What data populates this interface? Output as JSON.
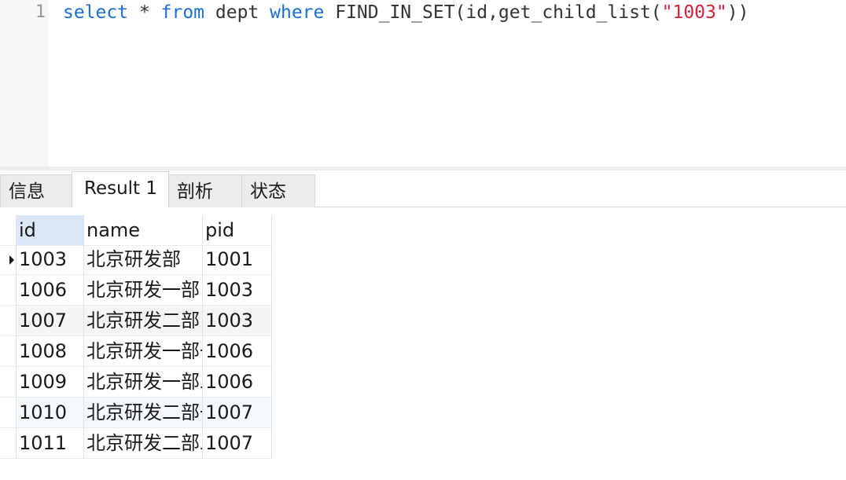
{
  "editor": {
    "line_number": "1",
    "sql": {
      "kw_select": "select",
      "t_star": " * ",
      "kw_from": "from",
      "t_table": " dept ",
      "kw_where": "where",
      "t_func": " FIND_IN_SET(id,get_child_list(",
      "str_arg": "\"1003\"",
      "t_close": "))"
    },
    "colors": {
      "keyword": "#1a6fd6",
      "string": "#d2233c",
      "plain": "#333333"
    }
  },
  "tabs": [
    {
      "label": "信息",
      "active": false
    },
    {
      "label": "Result 1",
      "active": true
    },
    {
      "label": "剖析",
      "active": false
    },
    {
      "label": "状态",
      "active": false
    }
  ],
  "grid": {
    "columns": [
      "id",
      "name",
      "pid"
    ],
    "rows": [
      [
        "1003",
        "北京研发部",
        "1001"
      ],
      [
        "1006",
        "北京研发一部",
        "1003"
      ],
      [
        "1007",
        "北京研发二部",
        "1003"
      ],
      [
        "1008",
        "北京研发一部一",
        "1006"
      ],
      [
        "1009",
        "北京研发一部二",
        "1006"
      ],
      [
        "1010",
        "北京研发二部一",
        "1007"
      ],
      [
        "1011",
        "北京研发二部二",
        "1007"
      ]
    ],
    "current_row_icon": "triangle-right-icon"
  }
}
